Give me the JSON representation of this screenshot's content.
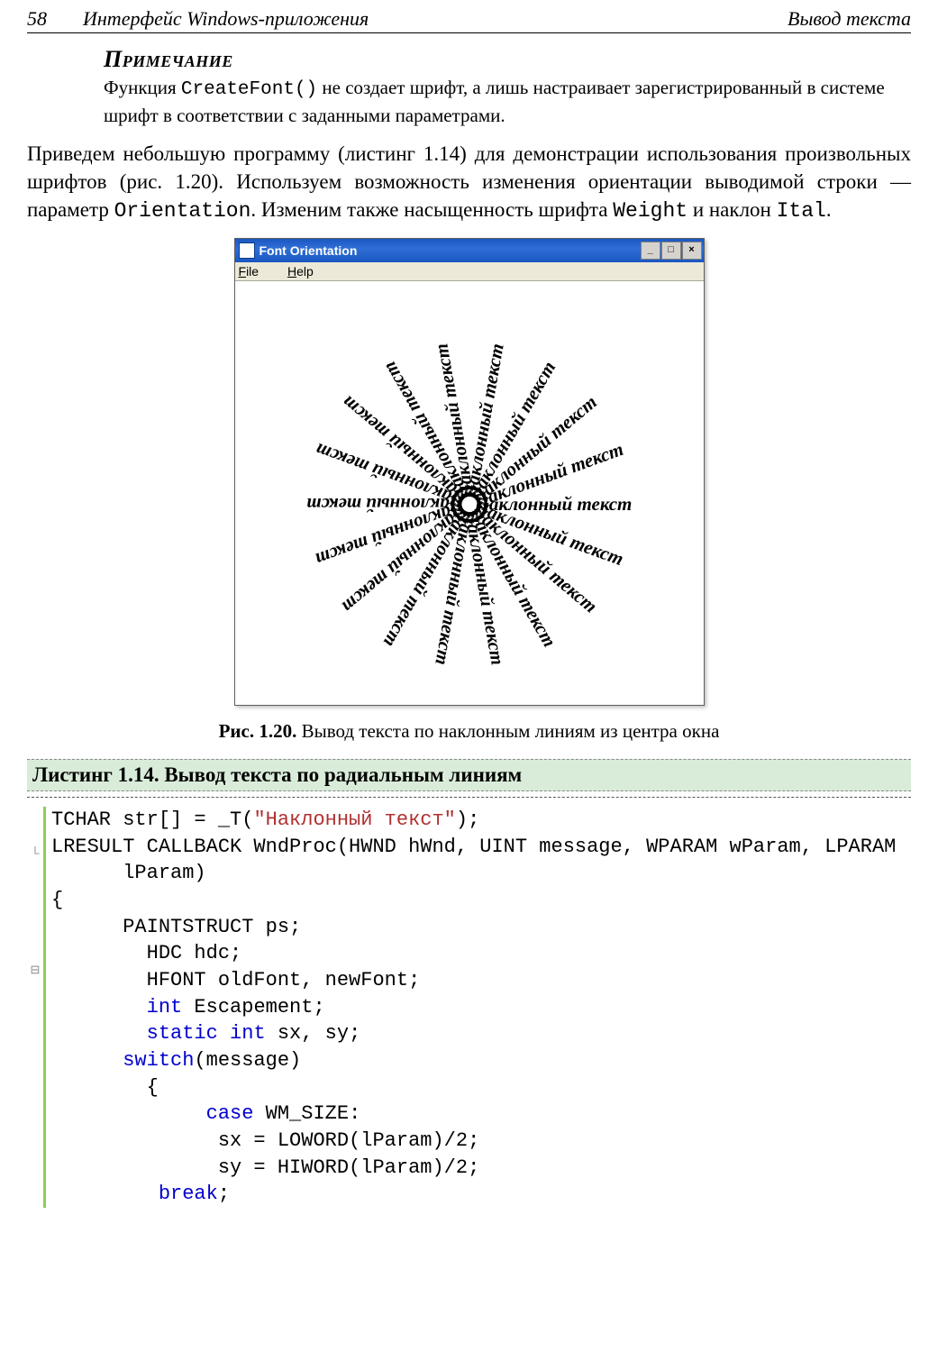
{
  "header": {
    "page_number": "58",
    "left": "Интерфейс Windows-приложения",
    "right": "Вывод текста"
  },
  "note": {
    "title": "Примечание",
    "body_pre": "Функция ",
    "body_mono": "CreateFont()",
    "body_post": " не создает шрифт, а лишь настраивает зарегистрированный в системе шрифт в соответствии с заданными параметрами."
  },
  "para": {
    "t1": "Приведем небольшую программу (листинг 1.14) для демонстрации использования произвольных шрифтов (рис. 1.20). Используем возможность изменения ориентации выводимой строки — параметр ",
    "m1": "Orientation",
    "t2": ". Изменим также насыщенность шрифта ",
    "m2": "Weight",
    "t3": " и наклон ",
    "m3": "Ital",
    "t4": "."
  },
  "window": {
    "title": "Font Orientation",
    "menu_file": "File",
    "menu_help": "Help",
    "btn_min": "_",
    "btn_max": "□",
    "btn_close": "×",
    "ray_text": "Наклонный текст"
  },
  "caption": {
    "label": "Рис. 1.20.",
    "text": " Вывод текста по наклонным линиям из центра окна"
  },
  "listing_header": "Листинг 1.14. Вывод текста по радиальным линиям",
  "code": {
    "l1a": "TCHAR str[] = _T(",
    "l1b": "\"Наклонный текст\"",
    "l1c": ");",
    "l2": "LRESULT CALLBACK WndProc(HWND hWnd, UINT message, WPARAM wParam, LPARAM",
    "l3": "      lParam)",
    "l4": "{",
    "l5": "      PAINTSTRUCT ps;",
    "l6": "        HDC hdc;",
    "l7": "        HFONT oldFont, newFont;",
    "l8a": "        ",
    "l8k": "int",
    "l8b": " Escapement;",
    "l9a": "        ",
    "l9k1": "static",
    "l9b": " ",
    "l9k2": "int",
    "l9c": " sx, sy;",
    "l10a": "      ",
    "l10k": "switch",
    "l10b": "(message)",
    "l11": "        {",
    "l12a": "             ",
    "l12k": "case",
    "l12b": " WM_SIZE:",
    "l13": "              sx = LOWORD(lParam)/2;",
    "l14": "              sy = HIWORD(lParam)/2;",
    "l15a": "         ",
    "l15k": "break",
    "l15b": ";"
  }
}
